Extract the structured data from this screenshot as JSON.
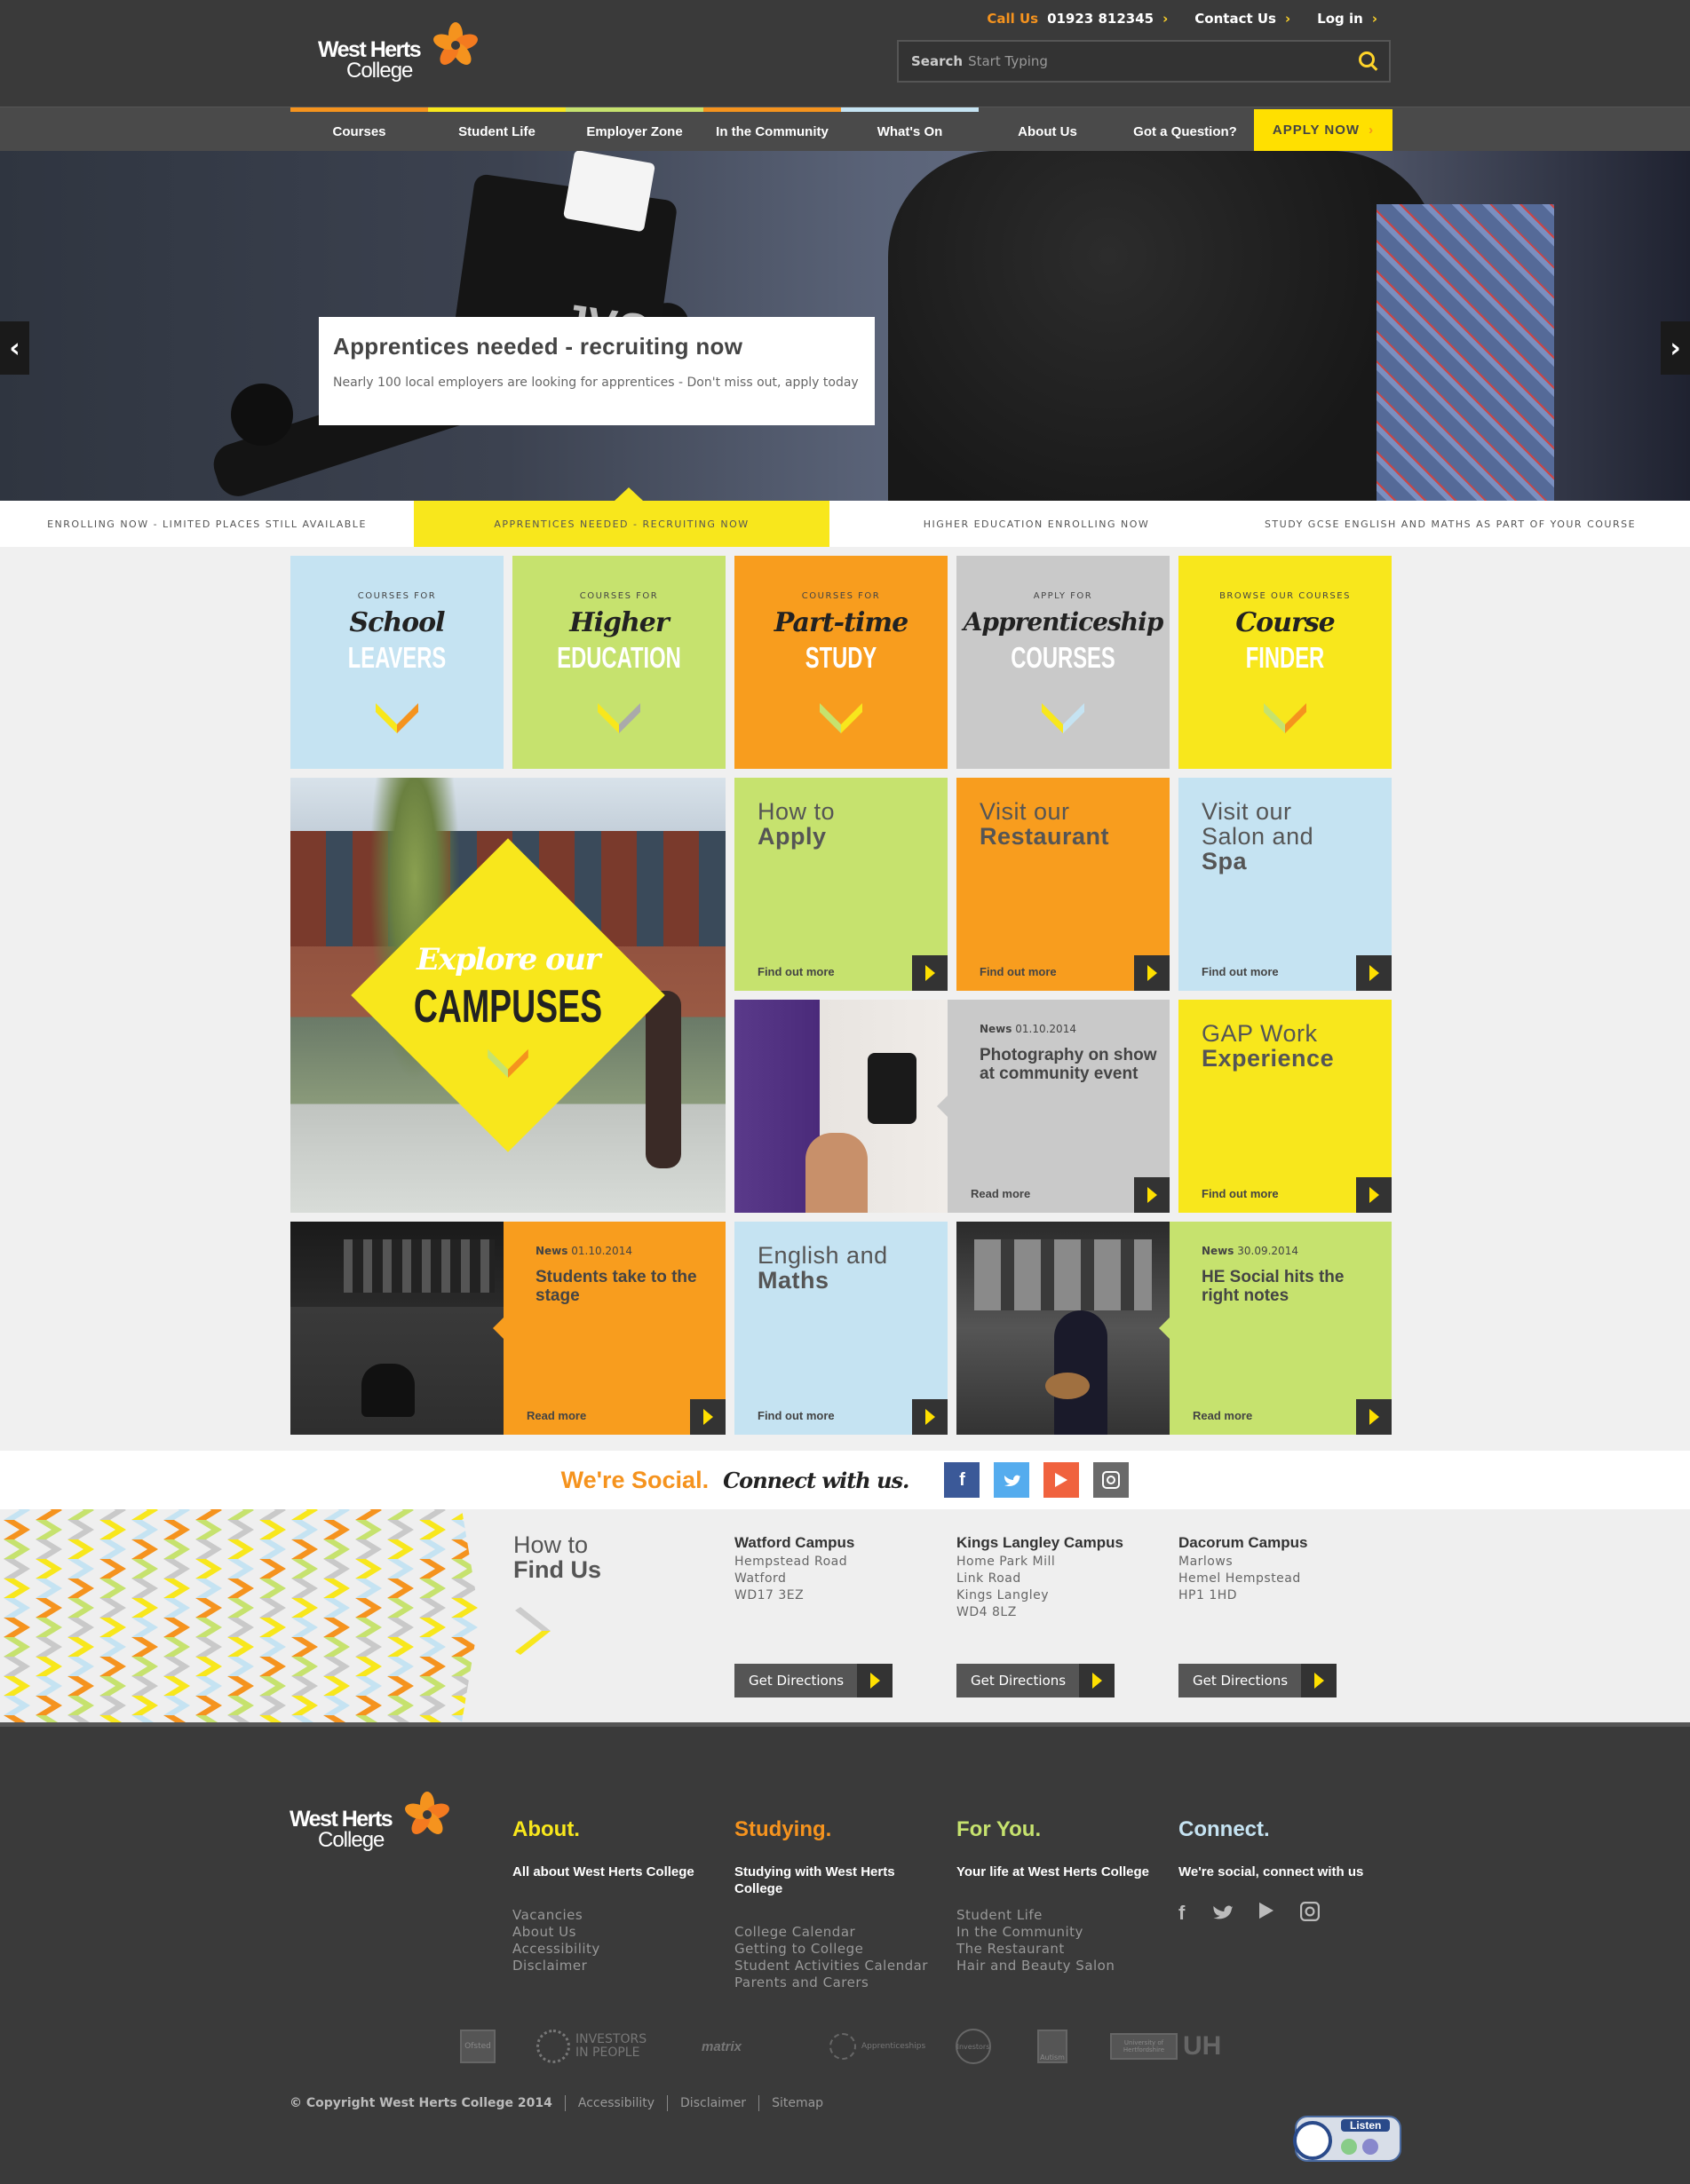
{
  "header": {
    "logo_line1": "West Herts",
    "logo_line2": "College",
    "call_label": "Call Us",
    "call_number": "01923 812345",
    "contact_label": "Contact Us",
    "login_label": "Log in",
    "search_label": "Search",
    "search_placeholder": "Start Typing"
  },
  "nav": {
    "items": [
      {
        "label": "Courses",
        "color": "#f5931e"
      },
      {
        "label": "Student Life",
        "color": "#f8e71c"
      },
      {
        "label": "Employer Zone",
        "color": "#c6e26e"
      },
      {
        "label": "In the Community",
        "color": "#f5931e"
      },
      {
        "label": "What's On",
        "color": "#c5e3f2"
      },
      {
        "label": "About Us",
        "color": "#4a4a4a"
      },
      {
        "label": "Got a Question?",
        "color": "#4a4a4a"
      }
    ],
    "apply_label": "APPLY NOW"
  },
  "hero": {
    "camera_label": "JVC",
    "title": "Apprentices needed - recruiting now",
    "text": "Nearly 100 local employers are looking for apprentices - Don't miss out, apply today",
    "prev": "‹",
    "next": "›"
  },
  "ticker": [
    "ENROLLING NOW - LIMITED PLACES STILL AVAILABLE",
    "APPRENTICES NEEDED - RECRUITING NOW",
    "HIGHER EDUCATION ENROLLING NOW",
    "STUDY GCSE ENGLISH AND MATHS AS PART OF YOUR COURSE"
  ],
  "courses": [
    {
      "pre": "COURSES FOR",
      "script": "School",
      "big": "LEAVERS",
      "color": "#c5e3f2"
    },
    {
      "pre": "COURSES FOR",
      "script": "Higher",
      "big": "EDUCATION",
      "color": "#c6e26e"
    },
    {
      "pre": "COURSES FOR",
      "script": "Part-time",
      "big": "STUDY",
      "color": "#f89d1e"
    },
    {
      "pre": "APPLY FOR",
      "script": "Apprenticeship",
      "big": "COURSES",
      "color": "#c9c9c9"
    },
    {
      "pre": "BROWSE OUR COURSES",
      "script": "Course",
      "big": "FINDER",
      "color": "#f8e71c"
    }
  ],
  "campuses_tile": {
    "script": "Explore our",
    "big": "CAMPUSES"
  },
  "tiles": {
    "apply": {
      "light": "How to",
      "bold": "Apply",
      "more": "Find out more"
    },
    "restaurant": {
      "light": "Visit our",
      "bold": "Restaurant",
      "more": "Find out more"
    },
    "salon": {
      "light": "Visit our Salon and",
      "bold": "Spa",
      "more": "Find out more"
    },
    "photo_news": {
      "label": "News",
      "date": "01.10.2014",
      "title": "Photography on show at community event",
      "more": "Read more"
    },
    "gap": {
      "light": "GAP Work",
      "bold": "Experience",
      "more": "Find out more"
    },
    "stage_news": {
      "label": "News",
      "date": "01.10.2014",
      "title": "Students take to the stage",
      "more": "Read more"
    },
    "english": {
      "light": "English and",
      "bold": "Maths",
      "more": "Find out more"
    },
    "he_news": {
      "label": "News",
      "date": "30.09.2014",
      "title": "HE Social hits the right notes",
      "more": "Read more"
    }
  },
  "social": {
    "lead": "We're Social.",
    "script": "Connect with us.",
    "icons": [
      "facebook-icon",
      "twitter-icon",
      "youtube-icon",
      "instagram-icon"
    ]
  },
  "findus": {
    "light": "How to",
    "bold": "Find Us",
    "campuses": [
      {
        "name": "Watford Campus",
        "lines": [
          "Hempstead Road",
          "Watford",
          "WD17 3EZ"
        ]
      },
      {
        "name": "Kings Langley Campus",
        "lines": [
          "Home Park Mill",
          "Link Road",
          "Kings Langley",
          "WD4 8LZ"
        ]
      },
      {
        "name": "Dacorum Campus",
        "lines": [
          "Marlows",
          "Hemel Hempstead",
          "HP1 1HD"
        ]
      }
    ],
    "directions_label": "Get Directions"
  },
  "footer": {
    "cols": [
      {
        "title": "About.",
        "color": "#f8e71c",
        "sub": "All about West Herts College",
        "links": [
          "Vacancies",
          "About Us",
          "Accessibility",
          "Disclaimer"
        ]
      },
      {
        "title": "Studying.",
        "color": "#f5931e",
        "sub": "Studying with West Herts College",
        "links": [
          "College Calendar",
          "Getting to College",
          "Student Activities Calendar",
          "Parents and Carers"
        ]
      },
      {
        "title": "For You.",
        "color": "#c6e26e",
        "sub": "Your life at West Herts College",
        "links": [
          "Student Life",
          "In the Community",
          "The Restaurant",
          "Hair and Beauty Salon"
        ]
      },
      {
        "title": "Connect.",
        "color": "#c5e3f2",
        "sub": "We're social, connect with us",
        "links": []
      }
    ],
    "partners": [
      "Ofsted",
      "INVESTORS IN PEOPLE",
      "matrix",
      "Apprenticeships",
      "Investors",
      "Autism",
      "University of Hertfordshire",
      "UH"
    ],
    "copyright": "© Copyright West Herts College 2014",
    "links": [
      "Accessibility",
      "Disclaimer",
      "Sitemap"
    ],
    "listen": "Listen"
  }
}
